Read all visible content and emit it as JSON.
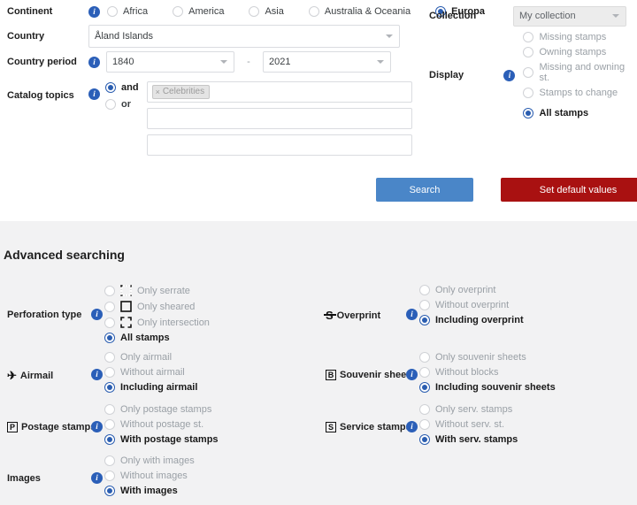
{
  "basic": {
    "continent": {
      "label": "Continent",
      "info_icon": "info-icon",
      "options": [
        {
          "label": "Africa",
          "selected": false
        },
        {
          "label": "America",
          "selected": false
        },
        {
          "label": "Asia",
          "selected": false
        },
        {
          "label": "Australia & Oceania",
          "selected": false
        },
        {
          "label": "Europa",
          "selected": true
        }
      ]
    },
    "country": {
      "label": "Country",
      "value": "Åland Islands"
    },
    "country_period": {
      "label": "Country period",
      "info_icon": "info-icon",
      "from": "1840",
      "to": "2021",
      "separator": "-"
    },
    "catalog_topics": {
      "label": "Catalog topics",
      "info_icon": "info-icon",
      "operators": [
        {
          "label": "and",
          "selected": true
        },
        {
          "label": "or",
          "selected": false
        }
      ],
      "chips": [
        "Celebrities"
      ],
      "field2_value": "",
      "field3_value": ""
    },
    "collection": {
      "label": "Collection",
      "value": "My collection",
      "disabled": true
    },
    "display": {
      "label": "Display",
      "info_icon": "info-icon",
      "options": [
        {
          "label": "Missing stamps",
          "selected": false,
          "disabled": true
        },
        {
          "label": "Owning stamps",
          "selected": false,
          "disabled": true
        },
        {
          "label": "Missing and owning st.",
          "selected": false,
          "disabled": true
        },
        {
          "label": "Stamps to change",
          "selected": false,
          "disabled": true
        },
        {
          "label": "All stamps",
          "selected": true,
          "disabled": false
        }
      ]
    },
    "buttons": {
      "search": "Search",
      "reset": "Set default values"
    }
  },
  "advanced": {
    "title": "Advanced searching",
    "groups": [
      {
        "key": "perforation",
        "label": "Perforation type",
        "icon": "",
        "info_icon": "info-icon",
        "options": [
          {
            "label": "Only serrate",
            "selected": false,
            "disabled": true,
            "icon": "serrate-icon"
          },
          {
            "label": "Only sheared",
            "selected": false,
            "disabled": true,
            "icon": "sheared-icon"
          },
          {
            "label": "Only intersection",
            "selected": false,
            "disabled": true,
            "icon": "intersection-icon"
          },
          {
            "label": "All stamps",
            "selected": true,
            "disabled": false,
            "icon": ""
          }
        ]
      },
      {
        "key": "overprint",
        "label": "Overprint",
        "icon": "overprint-icon",
        "info_icon": "info-icon",
        "options": [
          {
            "label": "Only overprint",
            "selected": false,
            "disabled": true,
            "icon": ""
          },
          {
            "label": "Without overprint",
            "selected": false,
            "disabled": true,
            "icon": ""
          },
          {
            "label": "Including overprint",
            "selected": true,
            "disabled": false,
            "icon": ""
          }
        ]
      },
      {
        "key": "airmail",
        "label": "Airmail",
        "icon": "airplane-icon",
        "info_icon": "info-icon",
        "options": [
          {
            "label": "Only airmail",
            "selected": false,
            "disabled": true,
            "icon": ""
          },
          {
            "label": "Without airmail",
            "selected": false,
            "disabled": true,
            "icon": ""
          },
          {
            "label": "Including airmail",
            "selected": true,
            "disabled": false,
            "icon": ""
          }
        ]
      },
      {
        "key": "souvenir",
        "label": "Souvenir sheets",
        "icon": "block-b-icon",
        "info_icon": "info-icon",
        "options": [
          {
            "label": "Only souvenir sheets",
            "selected": false,
            "disabled": true,
            "icon": ""
          },
          {
            "label": "Without blocks",
            "selected": false,
            "disabled": true,
            "icon": ""
          },
          {
            "label": "Including souvenir sheets",
            "selected": true,
            "disabled": false,
            "icon": ""
          }
        ]
      },
      {
        "key": "postage",
        "label": "Postage stamps",
        "icon": "postage-p-icon",
        "info_icon": "info-icon",
        "options": [
          {
            "label": "Only postage stamps",
            "selected": false,
            "disabled": true,
            "icon": ""
          },
          {
            "label": "Without postage st.",
            "selected": false,
            "disabled": true,
            "icon": ""
          },
          {
            "label": "With postage stamps",
            "selected": true,
            "disabled": false,
            "icon": ""
          }
        ]
      },
      {
        "key": "service",
        "label": "Service stamps",
        "icon": "service-s-icon",
        "info_icon": "info-icon",
        "options": [
          {
            "label": "Only serv. stamps",
            "selected": false,
            "disabled": true,
            "icon": ""
          },
          {
            "label": "Without serv. st.",
            "selected": false,
            "disabled": true,
            "icon": ""
          },
          {
            "label": "With serv. stamps",
            "selected": true,
            "disabled": false,
            "icon": ""
          }
        ]
      },
      {
        "key": "images",
        "label": "Images",
        "icon": "",
        "info_icon": "info-icon",
        "options": [
          {
            "label": "Only with images",
            "selected": false,
            "disabled": true,
            "icon": ""
          },
          {
            "label": "Without images",
            "selected": false,
            "disabled": true,
            "icon": ""
          },
          {
            "label": "With images",
            "selected": true,
            "disabled": false,
            "icon": ""
          }
        ]
      }
    ]
  },
  "colors": {
    "accent_blue": "#2a5db0",
    "info_blue": "#2b5fb8",
    "search_button": "#4a86c8",
    "reset_button": "#a91111",
    "advanced_bg": "#f2f2f3",
    "muted_text": "#9aa0a6"
  }
}
